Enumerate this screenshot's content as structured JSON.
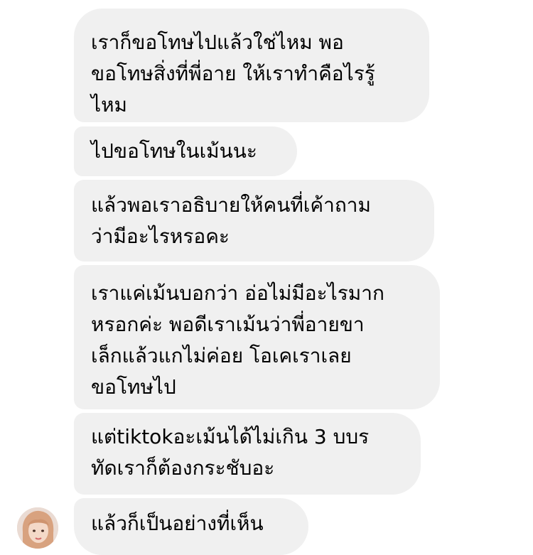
{
  "conversation": {
    "messages": [
      {
        "text": "เราก็ขอโทษไปแล้วใช่ไหม พอ\nขอโทษสิ่งที่พี่อาย ให้เราทำคือไรรู้\nไหม"
      },
      {
        "text": "ไปขอโทษในเม้นนะ"
      },
      {
        "text": "แล้วพอเราอธิบายให้คนที่เค้าถาม\nว่ามีอะไรหรอคะ"
      },
      {
        "text": "เราแค่เม้นบอกว่า อ่อไม่มีอะไรมาก\nหรอกค่ะ พอดีเราเม้นว่าพี่อายขา\nเล็กแล้วแกไม่ค่อย โอเคเราเลย\nขอโทษไป"
      },
      {
        "text": "แต่tiktokอะเม้นได้ไม่เกิน 3 บบร\nทัดเราก็ต้องกระชับอะ"
      },
      {
        "text": "แล้วก็เป็นอย่างที่เห็น"
      }
    ],
    "colors": {
      "bubble_bg": "#f0f0f0",
      "text": "#000000",
      "page_bg": "#ffffff"
    },
    "icons": {
      "sender_avatar": "avatar"
    }
  }
}
